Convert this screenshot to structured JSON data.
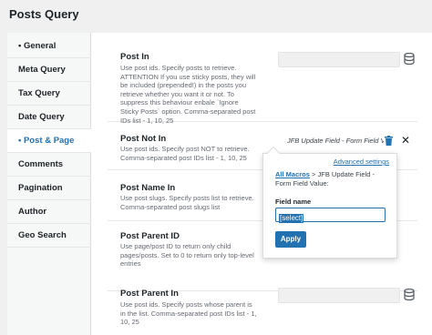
{
  "page": {
    "title": "Posts Query"
  },
  "sidebar": {
    "items": [
      {
        "label": "• General"
      },
      {
        "label": "Meta Query"
      },
      {
        "label": "Tax Query"
      },
      {
        "label": "Date Query"
      },
      {
        "label": "• Post & Page"
      },
      {
        "label": "Comments"
      },
      {
        "label": "Pagination"
      },
      {
        "label": "Author"
      },
      {
        "label": "Geo Search"
      }
    ],
    "active_index": 4
  },
  "fields": {
    "post_in": {
      "label": "Post In",
      "description": "Use post ids. Specify posts to retrieve. ATTENTION If you use sticky posts, they will be included (prepended!) in the posts you retrieve whether you want it or not. To suppress this behaviour enbale `Ignore Sticky Posts` option. Comma-separated post IDs list - 1, 10, 25"
    },
    "post_not_in": {
      "label": "Post Not In",
      "description": "Use post ids. Specify post NOT to retrieve. Comma-separated post IDs list - 1, 10, 25",
      "value": "JFB Update Field - Form Field Va..."
    },
    "post_name_in": {
      "label": "Post Name In",
      "description": "Use post slugs. Specify posts list to retrieve. Comma-separated post slugs list"
    },
    "post_parent_id": {
      "label": "Post Parent ID",
      "description": "Use page/post ID to return only child pages/posts. Set to 0 to return only top-level entries"
    },
    "post_parent_in": {
      "label": "Post Parent In",
      "description": "Use post ids. Specify posts whose parent is in the list. Comma-separated post IDs list - 1, 10, 25"
    }
  },
  "popup": {
    "advanced_settings": "Advanced settings",
    "crumb_link": "All Macros",
    "crumb_rest": " > JFB Update Field - Form Field Value:",
    "field_label": "Field name",
    "field_value": "[select]",
    "apply_label": "Apply"
  },
  "icons": {
    "database": "database-icon",
    "trash": "trash-icon",
    "close": "close-icon"
  },
  "colors": {
    "accent": "#2271b1",
    "text": "#1d2327"
  }
}
